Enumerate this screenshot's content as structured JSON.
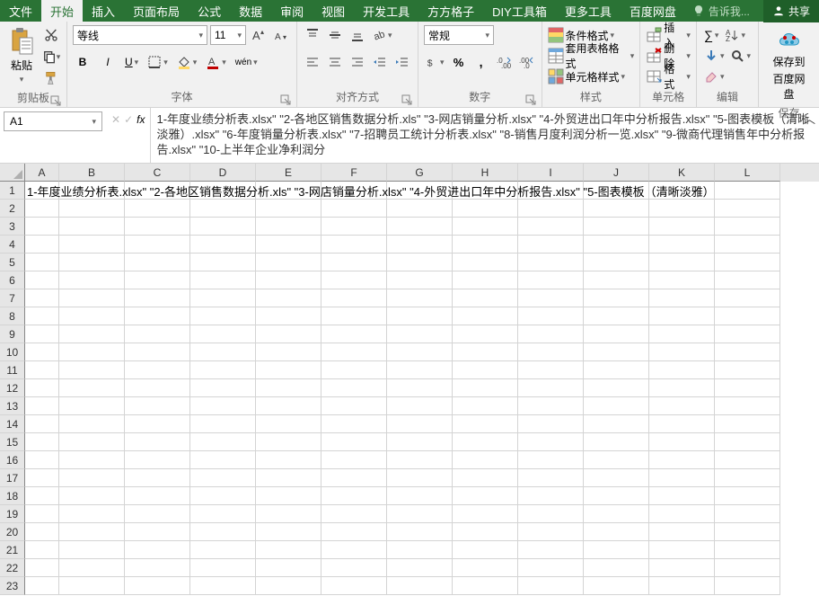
{
  "menu": {
    "file": "文件",
    "home": "开始",
    "insert": "插入",
    "layout": "页面布局",
    "formula": "公式",
    "data": "数据",
    "review": "审阅",
    "view": "视图",
    "devtools": "开发工具",
    "fangfang": "方方格子",
    "diy": "DIY工具箱",
    "more": "更多工具",
    "baidu": "百度网盘",
    "tellme": "告诉我...",
    "share": "共享"
  },
  "ribbon": {
    "clipboard": {
      "paste": "粘贴",
      "label": "剪贴板"
    },
    "font": {
      "name": "等线",
      "size": "11",
      "label": "字体",
      "pinyin": "wén"
    },
    "align": {
      "label": "对齐方式"
    },
    "number": {
      "fmt": "常规",
      "label": "数字"
    },
    "styles": {
      "cond": "条件格式",
      "tbl": "套用表格格式",
      "cell": "单元格样式",
      "label": "样式"
    },
    "cells": {
      "ins": "插入",
      "del": "删除",
      "fmt2": "格式",
      "label": "单元格"
    },
    "editing": {
      "label": "编辑"
    },
    "cloud": {
      "save": "保存到",
      "baidu": "百度网盘",
      "label": "保存"
    }
  },
  "namebox": "A1",
  "formula_bar": "1-年度业绩分析表.xlsx\" \"2-各地区销售数据分析.xls\" \"3-网店销量分析.xlsx\" \"4-外贸进出口年中分析报告.xlsx\" \"5-图表模板（清晰淡雅）.xlsx\" \"6-年度销量分析表.xlsx\" \"7-招聘员工统计分析表.xlsx\" \"8-销售月度利润分析一览.xlsx\" \"9-微商代理销售年中分析报告.xlsx\" \"10-上半年企业净利润分",
  "cell_a1": "1-年度业绩分析表.xlsx\" \"2-各地区销售数据分析.xls\" \"3-网店销量分析.xlsx\" \"4-外贸进出口年中分析报告.xlsx\" \"5-图表模板（清晰淡雅）",
  "cols": [
    "A",
    "B",
    "C",
    "D",
    "E",
    "F",
    "G",
    "H",
    "I",
    "J",
    "K",
    "L"
  ],
  "rows": [
    "1",
    "2",
    "3",
    "4",
    "5",
    "6",
    "7",
    "8",
    "9",
    "10",
    "11",
    "12",
    "13",
    "14",
    "15",
    "16",
    "17",
    "18",
    "19",
    "20",
    "21",
    "22",
    "23"
  ]
}
